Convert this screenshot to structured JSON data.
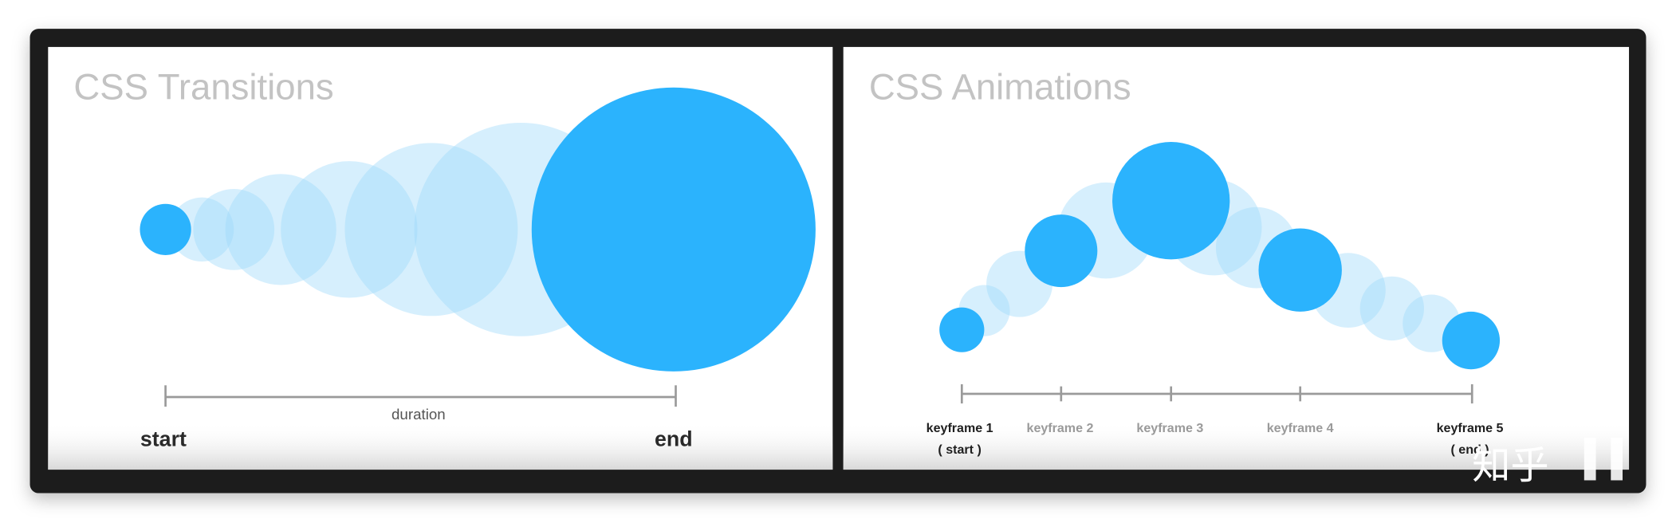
{
  "colors": {
    "accent": "#2bb3fd",
    "ghost": "#9dd9fa",
    "frame": "#1a1b1b",
    "axis": "#9a9a9a"
  },
  "left_panel": {
    "title": "CSS Transitions",
    "duration_label": "duration",
    "start_label": "start",
    "end_label": "end"
  },
  "right_panel": {
    "title": "CSS Animations",
    "keyframes": [
      {
        "label": "keyframe 1",
        "sub": "( start )",
        "emphasis": true
      },
      {
        "label": "keyframe 2",
        "sub": "",
        "emphasis": false
      },
      {
        "label": "keyframe 3",
        "sub": "",
        "emphasis": false
      },
      {
        "label": "keyframe 4",
        "sub": "",
        "emphasis": false
      },
      {
        "label": "keyframe 5",
        "sub": "( end )",
        "emphasis": true
      }
    ]
  },
  "watermark": "知乎"
}
